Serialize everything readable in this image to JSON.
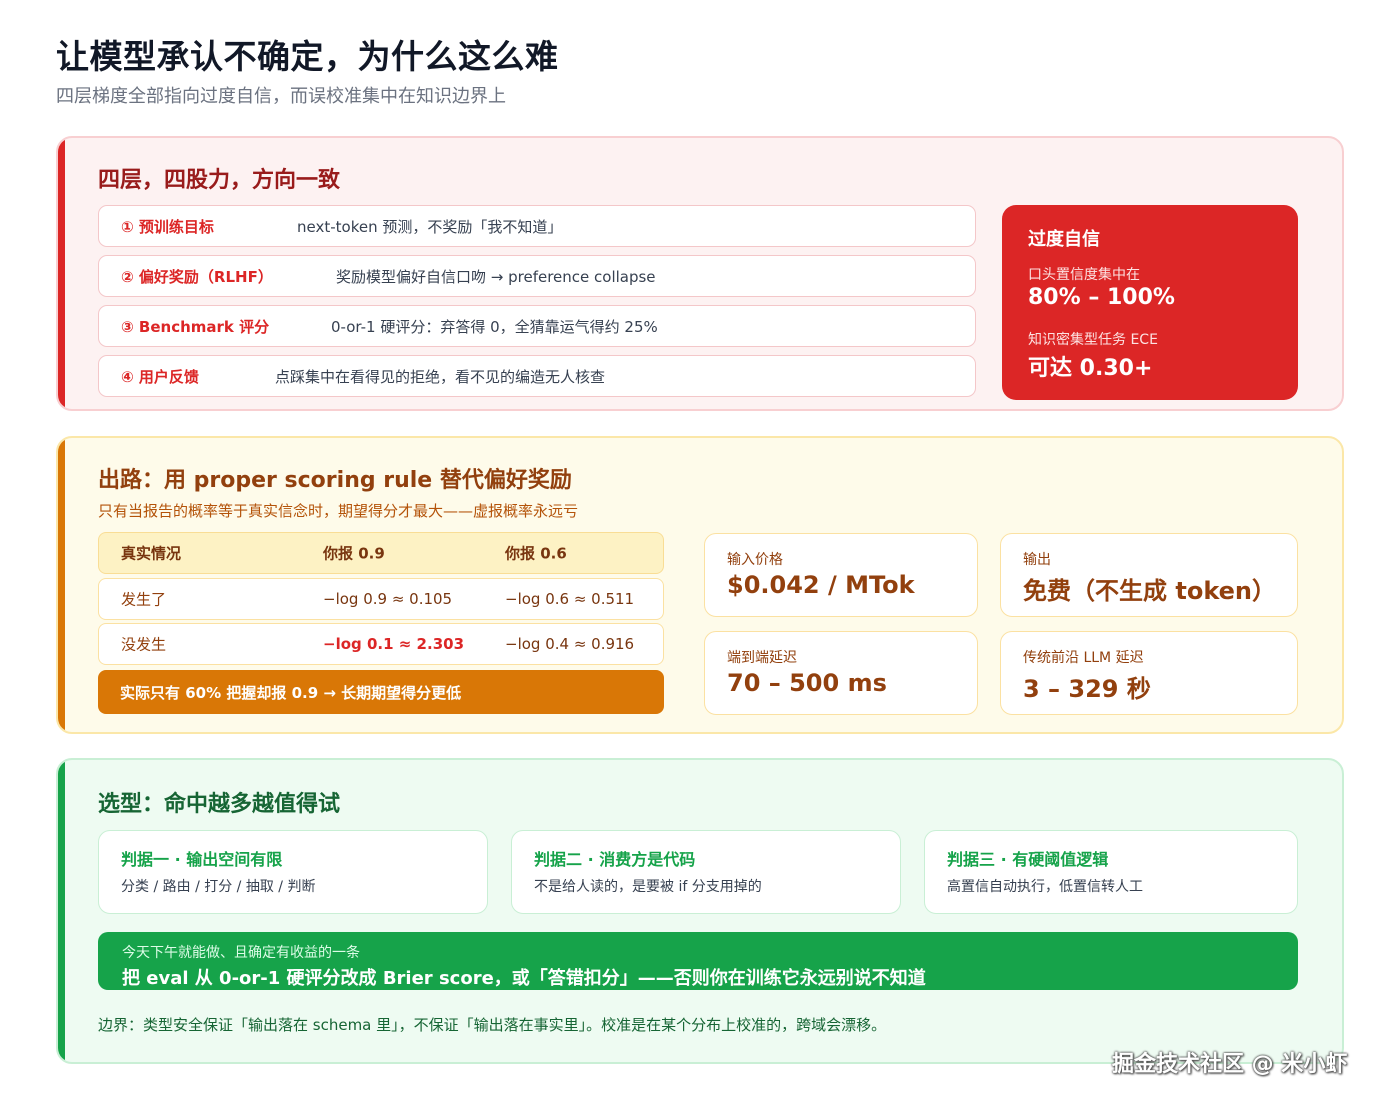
{
  "header": {
    "title": "让模型承认不确定，为什么这么难",
    "subtitle": "四层梯度全部指向过度自信，而误校准集中在知识边界上"
  },
  "section_layers": {
    "title": "四层，四股力，方向一致",
    "layers": [
      {
        "label": "① 预训练目标",
        "text": "next-token 预测，不奖励「我不知道」"
      },
      {
        "label": "② 偏好奖励（RLHF）",
        "text": "奖励模型偏好自信口吻 → preference collapse"
      },
      {
        "label": "③ Benchmark 评分",
        "text": "0-or-1 硬评分：弃答得 0，全猜靠运气得约 25%"
      },
      {
        "label": "④ 用户反馈",
        "text": "点踩集中在看得见的拒绝，看不见的编造无人核查"
      }
    ],
    "overconfidence": {
      "title": "过度自信",
      "label1": "口头置信度集中在",
      "value1": "80% – 100%",
      "label2": "知识密集型任务 ECE",
      "value2": "可达 0.30+"
    }
  },
  "section_scoring": {
    "title": "出路：用 proper scoring rule 替代偏好奖励",
    "subtitle": "只有当报告的概率等于真实信念时，期望得分才最大——虚报概率永远亏",
    "table": {
      "headers": [
        "真实情况",
        "你报 0.9",
        "你报 0.6"
      ],
      "rows": [
        [
          "发生了",
          "−log 0.9 ≈ 0.105",
          "−log 0.6 ≈ 0.511"
        ],
        [
          "没发生",
          "−log 0.1 ≈ 2.303",
          "−log 0.4 ≈ 0.916"
        ]
      ]
    },
    "conclusion": "实际只有 60% 把握却报 0.9 → 长期期望得分更低",
    "stats": [
      {
        "label": "输入价格",
        "value": "$0.042 / MTok"
      },
      {
        "label": "输出",
        "value": "免费（不生成 token）"
      },
      {
        "label": "端到端延迟",
        "value": "70 – 500 ms"
      },
      {
        "label": "传统前沿 LLM 延迟",
        "value": "3 – 329 秒"
      }
    ]
  },
  "section_selection": {
    "title": "选型：命中越多越值得试",
    "criteria": [
      {
        "title": "判据一 · 输出空间有限",
        "text": "分类 / 路由 / 打分 / 抽取 / 判断"
      },
      {
        "title": "判据二 · 消费方是代码",
        "text": "不是给人读的，是要被 if 分支用掉的"
      },
      {
        "title": "判据三 · 有硬阈值逻辑",
        "text": "高置信自动执行，低置信转人工"
      }
    ],
    "action": {
      "label": "今天下午就能做、且确定有收益的一条",
      "text": "把 eval 从 0-or-1 硬评分改成 Brier score，或「答错扣分」——否则你在训练它永远别说不知道"
    },
    "boundary": "边界：类型安全保证「输出落在 schema 里」，不保证「输出落在事实里」。校准是在某个分布上校准的，跨域会漂移。"
  },
  "watermark": "掘金技术社区 @ 米小虾",
  "colors": {
    "red": "#dc2626",
    "amber": "#d97706",
    "green": "#16a34a"
  }
}
